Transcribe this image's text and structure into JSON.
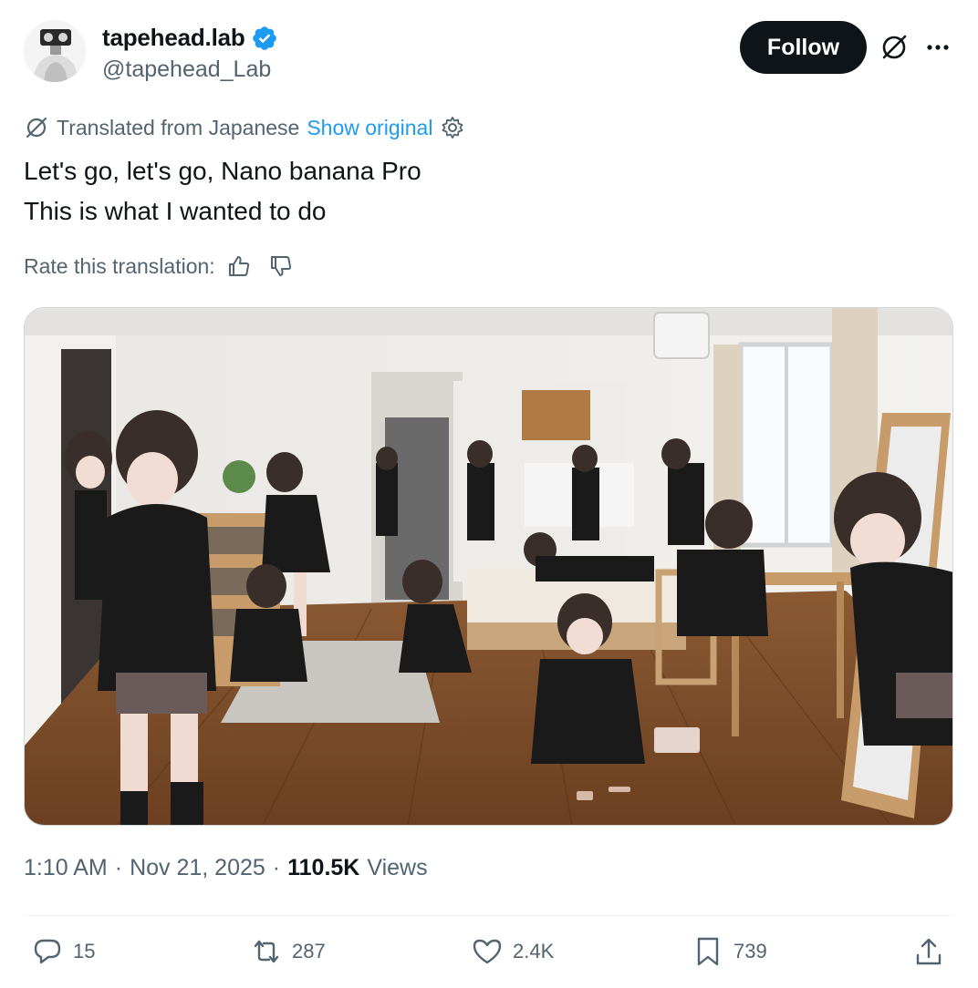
{
  "author": {
    "display_name": "tapehead.lab",
    "handle": "@tapehead_Lab",
    "follow_label": "Follow"
  },
  "translation": {
    "translated_from": "Translated from Japanese",
    "show_original": "Show original",
    "rate_label": "Rate this translation:"
  },
  "tweet": {
    "line1": "Let's go, let's go, Nano banana Pro",
    "line2": "This is what I wanted to do"
  },
  "meta": {
    "time": "1:10 AM",
    "sep1": "·",
    "date": "Nov 21, 2025",
    "sep2": "·",
    "views_count": "110.5K",
    "views_label": "Views"
  },
  "actions": {
    "replies": "15",
    "reposts": "287",
    "likes": "2.4K",
    "bookmarks": "739"
  },
  "icons": {
    "verified": "verified-badge-icon",
    "grok": "grok-icon",
    "more": "more-icon",
    "translate": "translate-icon",
    "settings": "gear-icon",
    "thumbs_up": "thumbs-up-icon",
    "thumbs_down": "thumbs-down-icon",
    "reply": "reply-icon",
    "repost": "repost-icon",
    "like": "heart-icon",
    "bookmark": "bookmark-icon",
    "share": "share-icon"
  },
  "colors": {
    "accent": "#1d9bf0",
    "text_primary": "#0f1419",
    "text_secondary": "#536471",
    "follow_bg": "#0f1419"
  }
}
